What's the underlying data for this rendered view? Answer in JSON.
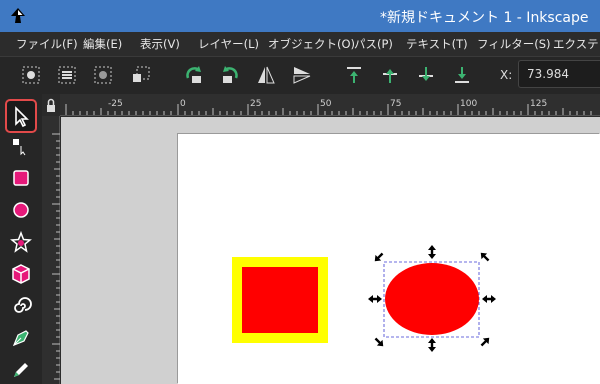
{
  "window": {
    "title": "*新規ドキュメント 1 - Inkscape"
  },
  "menubar": {
    "items": [
      "ファイル(F)",
      "編集(E)",
      "表示(V)",
      "レイヤー(L)",
      "オブジェクト(O)",
      "パス(P)",
      "テキスト(T)",
      "フィルター(S)",
      "エクステンシ"
    ]
  },
  "toolbar": {
    "x_label": "X:",
    "x_value": "73.984"
  },
  "ruler": {
    "labels": [
      "-25",
      "0",
      "25",
      "50",
      "75",
      "100",
      "125"
    ]
  },
  "colors": {
    "rect_fill": "#ff0000",
    "rect_stroke": "#ffff00",
    "ellipse_fill": "#ff0000",
    "selection_dash": "#3b3bd1",
    "tool_highlight": "#e24a4a"
  },
  "icons": {
    "toolbox": [
      "selector-arrow-icon",
      "node-editor-icon",
      "rectangle-icon",
      "ellipse-icon",
      "star-icon",
      "3d-box-icon",
      "spiral-icon",
      "pen-icon",
      "pencil-icon"
    ]
  }
}
